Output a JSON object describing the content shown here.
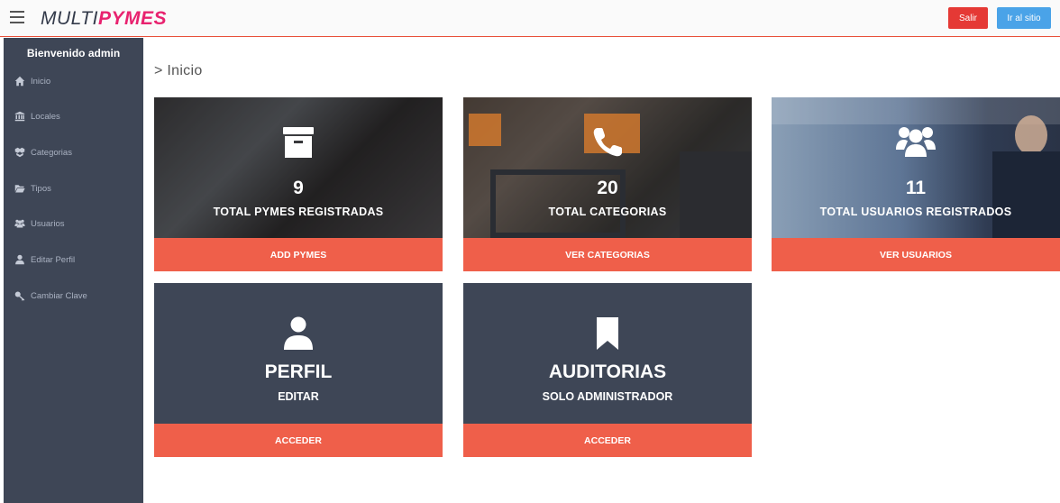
{
  "header": {
    "brand_part1": "MULTI",
    "brand_part2": "PYMES",
    "logout_label": "Salir",
    "site_label": "Ir al sitio"
  },
  "sidebar": {
    "welcome": "Bienvenido admin",
    "items": [
      {
        "label": "Inicio",
        "icon": "home-icon"
      },
      {
        "label": "Locales",
        "icon": "building-icon"
      },
      {
        "label": "Categorias",
        "icon": "cubes-icon"
      },
      {
        "label": "Tipos",
        "icon": "folder-icon"
      },
      {
        "label": "Usuarios",
        "icon": "users-icon"
      },
      {
        "label": "Editar Perfil",
        "icon": "user-icon"
      },
      {
        "label": "Cambiar Clave",
        "icon": "key-icon"
      }
    ]
  },
  "main": {
    "title": "> Inicio",
    "cards": [
      {
        "number": "9",
        "label": "TOTAL PYMES REGISTRADAS",
        "action": "ADD PYMES",
        "icon": "archive-icon"
      },
      {
        "number": "20",
        "label": "TOTAL CATEGORIAS",
        "action": "VER CATEGORIAS",
        "icon": "phone-icon"
      },
      {
        "number": "11",
        "label": "TOTAL USUARIOS REGISTRADOS",
        "action": "VER USUARIOS",
        "icon": "users-icon"
      },
      {
        "title": "PERFIL",
        "subtitle": "EDITAR",
        "action": "ACCEDER",
        "icon": "user-icon"
      },
      {
        "title": "AUDITORIAS",
        "subtitle": "SOLO ADMINISTRADOR",
        "action": "ACCEDER",
        "icon": "bookmark-icon"
      }
    ]
  },
  "colors": {
    "accent": "#ef5f4a",
    "sidebar": "#3e4656",
    "brand_pink": "#e8226f",
    "logout": "#e53935",
    "site_button": "#4aa3e8"
  }
}
